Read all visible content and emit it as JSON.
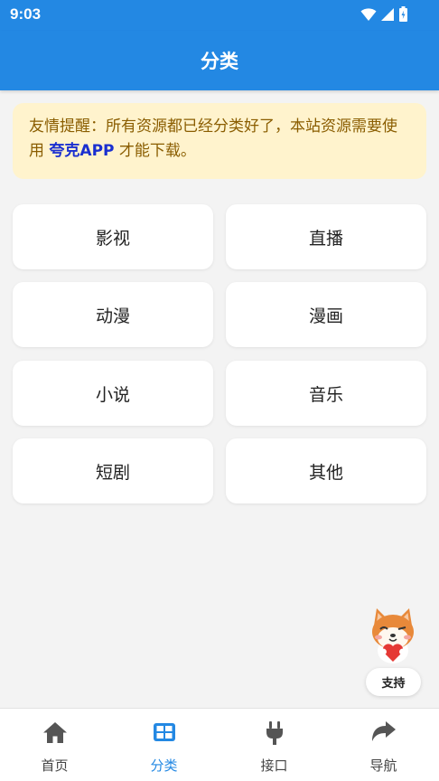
{
  "status_bar": {
    "time": "9:03",
    "icons": [
      "wifi-icon",
      "signal-icon",
      "battery-icon"
    ]
  },
  "app_bar": {
    "title": "分类"
  },
  "notice": {
    "text_before": "友情提醒：所有资源都已经分类好了，本站资源需要使用 ",
    "highlight": "夸克APP",
    "text_after": " 才能下载。"
  },
  "categories": [
    "影视",
    "直播",
    "动漫",
    "漫画",
    "小说",
    "音乐",
    "短剧",
    "其他"
  ],
  "support": {
    "label": "支持",
    "mascot_icon": "shiba-dog-heart-icon"
  },
  "bottom_nav": {
    "items": [
      {
        "label": "首页",
        "icon": "home-icon"
      },
      {
        "label": "分类",
        "icon": "grid-icon"
      },
      {
        "label": "接口",
        "icon": "plug-icon"
      },
      {
        "label": "导航",
        "icon": "share-arrow-icon"
      }
    ],
    "active_index": 1
  },
  "colors": {
    "primary": "#2388e3",
    "notice_bg": "#fff3cd",
    "notice_text": "#8a5d00",
    "highlight": "#1a2fd0"
  }
}
